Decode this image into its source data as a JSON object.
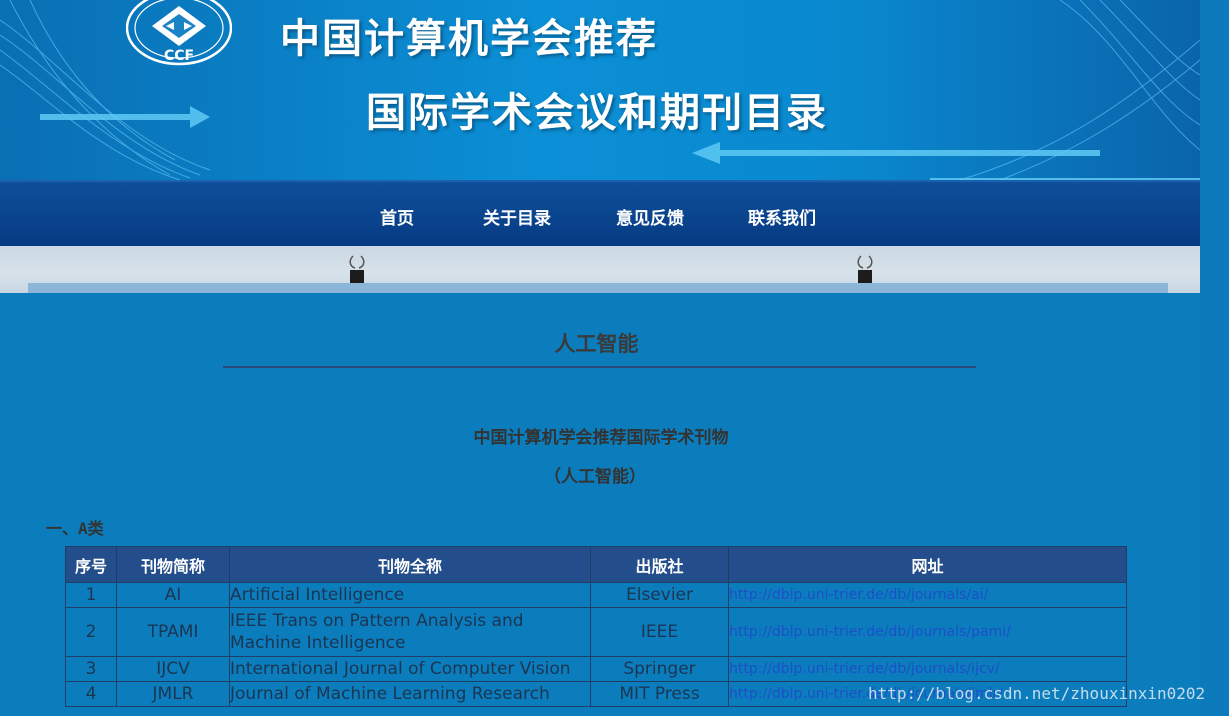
{
  "banner": {
    "logo_text": "CCF",
    "title_line1": "中国计算机学会推荐",
    "title_line2": "国际学术会议和期刊目录"
  },
  "nav": {
    "items": [
      "首页",
      "关于目录",
      "意见反馈",
      "联系我们"
    ]
  },
  "content": {
    "section_title": "人工智能",
    "subtitle": "中国计算机学会推荐国际学术刊物",
    "subtitle_paren": "（人工智能）",
    "category": "一、A类"
  },
  "table": {
    "headers": [
      "序号",
      "刊物简称",
      "刊物全称",
      "出版社",
      "网址"
    ],
    "rows": [
      {
        "no": "1",
        "abbr": "AI",
        "full": "Artificial Intelligence",
        "publisher": "Elsevier",
        "url": "http://dblp.uni-trier.de/db/journals/ai/"
      },
      {
        "no": "2",
        "abbr": "TPAMI",
        "full": "IEEE Trans on Pattern Analysis and Machine Intelligence",
        "publisher": "IEEE",
        "url": "http://dblp.uni-trier.de/db/journals/pami/"
      },
      {
        "no": "3",
        "abbr": "IJCV",
        "full": "International Journal of Computer Vision",
        "publisher": "Springer",
        "url": "http://dblp.uni-trier.de/db/journals/ijcv/"
      },
      {
        "no": "4",
        "abbr": "JMLR",
        "full": "Journal of Machine Learning Research",
        "publisher": "MIT Press",
        "url": "http://dblp.uni-trier.de/db/journals/jmlr/"
      }
    ]
  },
  "watermark": "http://blog.csdn.net/zhouxinxin0202"
}
